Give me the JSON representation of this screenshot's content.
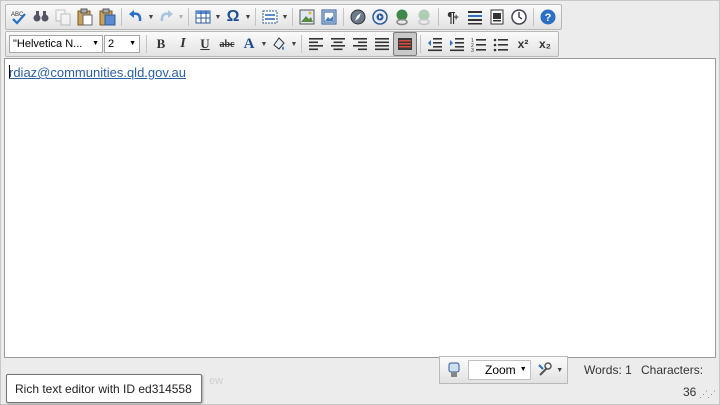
{
  "toolbar1": {
    "items": [
      {
        "name": "spellcheck-icon",
        "glyph": "ABC"
      },
      {
        "name": "find-icon",
        "glyph": "🔍"
      },
      {
        "name": "copy-icon",
        "glyph": "⎘"
      },
      {
        "name": "paste-icon",
        "glyph": "📋"
      },
      {
        "name": "paste-text-icon",
        "glyph": "📄"
      },
      {
        "name": "undo-icon",
        "glyph": "↶"
      },
      {
        "name": "redo-icon",
        "glyph": "↷"
      },
      {
        "name": "table-icon",
        "glyph": "▦"
      },
      {
        "name": "special-character-icon",
        "glyph": "Ω"
      },
      {
        "name": "layout-icon",
        "glyph": "▤"
      },
      {
        "name": "image-icon",
        "glyph": "🖼"
      },
      {
        "name": "image-gallery-icon",
        "glyph": "🖼"
      },
      {
        "name": "link-icon",
        "glyph": "🧭"
      },
      {
        "name": "media-icon",
        "glyph": "◉"
      },
      {
        "name": "hyperlink-icon",
        "glyph": "🔗"
      },
      {
        "name": "unlink-icon",
        "glyph": "🔗"
      },
      {
        "name": "paragraph-icon",
        "glyph": "¶"
      },
      {
        "name": "justify-icon",
        "glyph": "≣"
      },
      {
        "name": "template-icon",
        "glyph": "▣"
      },
      {
        "name": "time-icon",
        "glyph": "🕓"
      },
      {
        "name": "help-icon",
        "glyph": "?"
      }
    ]
  },
  "toolbar2": {
    "font_name": "\"Helvetica N...",
    "font_size": "2",
    "bold": "B",
    "italic": "I",
    "underline": "U",
    "strikethrough": "abc",
    "text_color": "A",
    "superscript": "x²",
    "subscript": "x₂"
  },
  "content": {
    "email": "rdiaz@communities.qld.gov.au"
  },
  "status": {
    "zoom_label": "Zoom",
    "words": "Words: 1",
    "characters_label": "Characters:",
    "characters_value": "36"
  },
  "tooltip": {
    "text": "Rich text editor with ID ed314558"
  },
  "ghost_text": "ew",
  "colors": {
    "link": "#2b5fa3",
    "toolbar_bg": "#ececec"
  }
}
